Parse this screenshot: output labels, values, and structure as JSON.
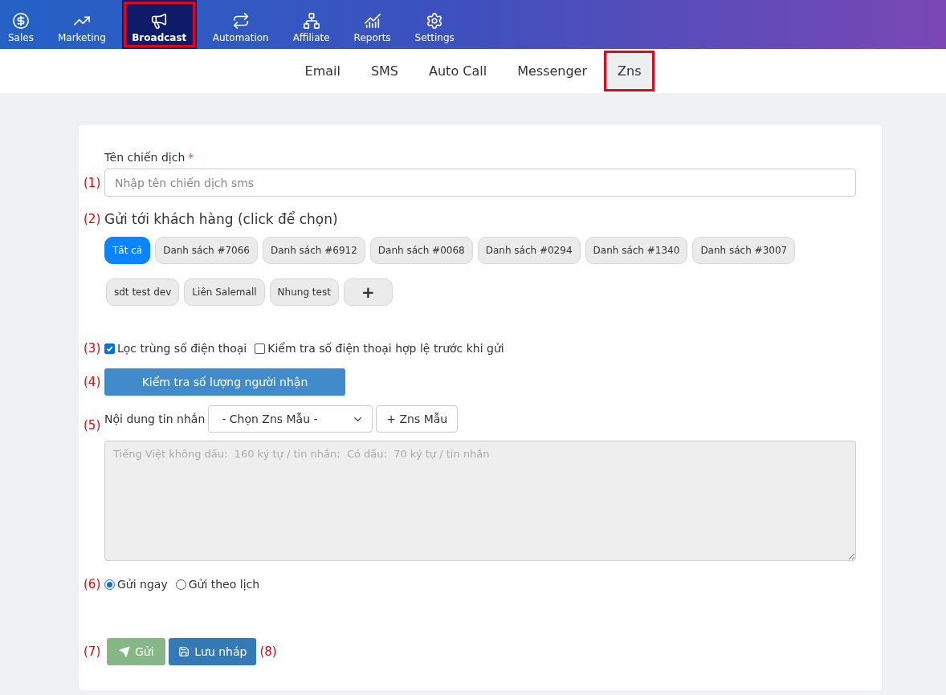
{
  "top_nav": [
    {
      "label": "Sales",
      "selected": false,
      "highlighted": false
    },
    {
      "label": "Marketing",
      "selected": false,
      "highlighted": false
    },
    {
      "label": "Broadcast",
      "selected": true,
      "highlighted": true
    },
    {
      "label": "Automation",
      "selected": false,
      "highlighted": false
    },
    {
      "label": "Affiliate",
      "selected": false,
      "highlighted": false
    },
    {
      "label": "Reports",
      "selected": false,
      "highlighted": false
    },
    {
      "label": "Settings",
      "selected": false,
      "highlighted": false
    }
  ],
  "sub_tabs": [
    {
      "label": "Email",
      "selected": false,
      "highlighted": false
    },
    {
      "label": "SMS",
      "selected": false,
      "highlighted": false
    },
    {
      "label": "Auto Call",
      "selected": false,
      "highlighted": false
    },
    {
      "label": "Messenger",
      "selected": false,
      "highlighted": false
    },
    {
      "label": "Zns",
      "selected": true,
      "highlighted": true
    }
  ],
  "form": {
    "campaign_name": {
      "label": "Tên chiến dịch",
      "required_mark": "*",
      "marker": "(1)",
      "placeholder": "Nhập tên chiến dịch sms"
    },
    "recipients": {
      "marker": "(2)",
      "heading": "Gửi tới khách hàng (click để chọn)",
      "chips": [
        {
          "label": "Tất cả",
          "selected": true
        },
        {
          "label": "Danh sách #7066",
          "selected": false
        },
        {
          "label": "Danh sách #6912",
          "selected": false
        },
        {
          "label": "Danh sách #0068",
          "selected": false
        },
        {
          "label": "Danh sách #0294",
          "selected": false
        },
        {
          "label": "Danh sách #1340",
          "selected": false
        },
        {
          "label": "Danh sách #3007",
          "selected": false
        },
        {
          "label": "sdt test dev",
          "selected": false
        },
        {
          "label": "Liên Salemall",
          "selected": false
        },
        {
          "label": "Nhung test",
          "selected": false
        }
      ],
      "add_label": "+"
    },
    "options": {
      "marker": "(3)",
      "checkboxes": [
        {
          "label": "Lọc trùng số điện thoại",
          "checked": true
        },
        {
          "label": "Kiểm tra số điện thoại hợp lệ trước khi gửi",
          "checked": false
        }
      ]
    },
    "check_button": {
      "marker": "(4)",
      "label": "Kiểm tra số lượng người nhận"
    },
    "message": {
      "marker": "(5)",
      "label": "Nội dung tin nhắn",
      "template_select": "- Chọn Zns Mẫu -",
      "add_template": "+ Zns Mẫu",
      "placeholder": "Tiếng Việt không dấu:  160 ký tự / tin nhắn;  Có dấu:  70 ký tự / tin nhắn"
    },
    "schedule": {
      "marker": "(6)",
      "radios": [
        {
          "label": "Gửi ngay",
          "selected": true
        },
        {
          "label": "Gửi theo lịch",
          "selected": false
        }
      ]
    },
    "actions": {
      "send": {
        "marker": "(7)",
        "label": "Gửi"
      },
      "draft": {
        "label": "Lưu nháp",
        "marker": "(8)"
      }
    }
  }
}
